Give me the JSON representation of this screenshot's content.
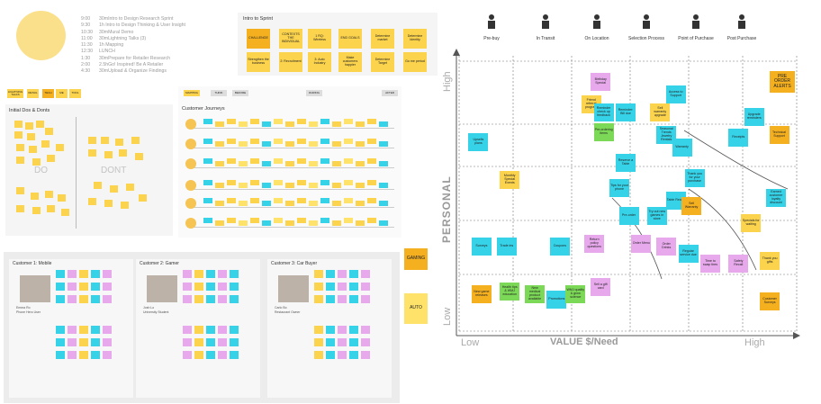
{
  "schedule": [
    {
      "time": "9:00",
      "item": "30mIntro to Design Research Sprint"
    },
    {
      "time": "9:30",
      "item": "1h Intro to Design Thinking & User Insight"
    },
    {
      "time": "10:30",
      "item": "30mMural Demo"
    },
    {
      "time": "11:00",
      "item": "30mLightning Talks (3)"
    },
    {
      "time": "11:30",
      "item": "1h Mapping"
    },
    {
      "time": "12:30",
      "item": "LUNCH"
    },
    {
      "time": "1:30",
      "item": "30mPrepare for Retailer Research"
    },
    {
      "time": "2:00",
      "item": "2.5hGo! Inspired! Be A Retailer"
    },
    {
      "time": "4:30",
      "item": "30mUpload & Organize Findings"
    }
  ],
  "intro": {
    "title": "Intro to Sprint",
    "notes": [
      "CHALLENGE",
      "CONTEXTS THE INDIVIDUAL",
      "1 RQ: Wireless",
      "END GOALS",
      "Determine market",
      "Determine Identity",
      "Strengthen the business",
      "2: Recruitment",
      "3: Auto Industry",
      "Make customers happier",
      "Determine Target",
      "Go me period"
    ]
  },
  "dos": {
    "title": "Initial Dos & Donts",
    "do_label": "DO",
    "dont_label": "DONT"
  },
  "journeys": {
    "title": "Customer Journeys",
    "phases": [
      "MAPPING",
      "THINK",
      "BEFORE",
      "DURING",
      "AFTER"
    ]
  },
  "left_tags": [
    "LIGHTNING TALKS",
    "RETAIL",
    "TECH",
    "ME",
    "TOOL"
  ],
  "personas": [
    {
      "title": "Customer 1: Mobile",
      "name": "Emma Ro",
      "role": "Phone Hero User"
    },
    {
      "title": "Customer 2: Gamer",
      "name": "Josh Lo",
      "role": "University Student"
    },
    {
      "title": "Customer 3: Car Buyer",
      "name": "Carlo Bo",
      "role": "Restaurant Owner"
    }
  ],
  "side_tags": [
    "GAMING",
    "AUTO"
  ],
  "stages": [
    "Pre-buy",
    "In Transit",
    "On Location",
    "Selection Process",
    "Point of Purchase",
    "Post Purchase"
  ],
  "chart_data": {
    "type": "scatter",
    "title": "",
    "xlabel": "VALUE $/Need",
    "ylabel": "PERSONAL",
    "x_ticks": [
      "Low",
      "High"
    ],
    "y_ticks": [
      "High",
      "Low"
    ],
    "corner_note": "PRE ORDER ALERTS",
    "notes": [
      {
        "label": "Birthday Special",
        "x": 0.42,
        "y": 0.94,
        "color": "#e7a9ec"
      },
      {
        "label": "Friend referral program",
        "x": 0.39,
        "y": 0.85,
        "color": "#fbd34d"
      },
      {
        "label": "Reminder check up feedback",
        "x": 0.43,
        "y": 0.82,
        "color": "#36d3e8"
      },
      {
        "label": "Reminder: Bill due",
        "x": 0.5,
        "y": 0.82,
        "color": "#36d3e8"
      },
      {
        "label": "Access to Support",
        "x": 0.66,
        "y": 0.89,
        "color": "#36d3e8"
      },
      {
        "label": "Sell warranty upgrade",
        "x": 0.61,
        "y": 0.82,
        "color": "#fbd34d"
      },
      {
        "label": "Upgrade reminders",
        "x": 0.91,
        "y": 0.8,
        "color": "#36d3e8"
      },
      {
        "label": "Pre-ordering items",
        "x": 0.43,
        "y": 0.74,
        "color": "#7cd957"
      },
      {
        "label": "Seasonal Trends Jewelry Rentals",
        "x": 0.63,
        "y": 0.73,
        "color": "#36d3e8"
      },
      {
        "label": "Receipts",
        "x": 0.86,
        "y": 0.72,
        "color": "#36d3e8"
      },
      {
        "label": "Technical Support",
        "x": 0.99,
        "y": 0.73,
        "color": "#f5b020"
      },
      {
        "label": "Upsells plans",
        "x": 0.03,
        "y": 0.7,
        "color": "#36d3e8"
      },
      {
        "label": "Reserve a Table",
        "x": 0.5,
        "y": 0.62,
        "color": "#36d3e8"
      },
      {
        "label": "Warranty",
        "x": 0.68,
        "y": 0.68,
        "color": "#36d3e8"
      },
      {
        "label": "Monthly Special Events",
        "x": 0.13,
        "y": 0.55,
        "color": "#fbd34d"
      },
      {
        "label": "Tips for your phone",
        "x": 0.48,
        "y": 0.52,
        "color": "#36d3e8"
      },
      {
        "label": "Thank you for your purchase",
        "x": 0.72,
        "y": 0.56,
        "color": "#36d3e8"
      },
      {
        "label": "Table Ready",
        "x": 0.66,
        "y": 0.47,
        "color": "#36d3e8"
      },
      {
        "label": "Sell Warranty",
        "x": 0.71,
        "y": 0.45,
        "color": "#f5b020"
      },
      {
        "label": "Earned customer loyalty discount",
        "x": 0.98,
        "y": 0.48,
        "color": "#36d3e8"
      },
      {
        "label": "Pre-order",
        "x": 0.51,
        "y": 0.41,
        "color": "#36d3e8"
      },
      {
        "label": "Try out new games in store",
        "x": 0.6,
        "y": 0.41,
        "color": "#36d3e8"
      },
      {
        "label": "Specials for waiting",
        "x": 0.9,
        "y": 0.38,
        "color": "#fbd34d"
      },
      {
        "label": "Surveys",
        "x": 0.04,
        "y": 0.29,
        "color": "#36d3e8"
      },
      {
        "label": "Trade ins",
        "x": 0.12,
        "y": 0.29,
        "color": "#36d3e8"
      },
      {
        "label": "Coupons",
        "x": 0.29,
        "y": 0.29,
        "color": "#36d3e8"
      },
      {
        "label": "Return policy questions",
        "x": 0.4,
        "y": 0.3,
        "color": "#e7a9ec"
      },
      {
        "label": "Order Menu",
        "x": 0.55,
        "y": 0.3,
        "color": "#e7a9ec"
      },
      {
        "label": "Order Drinks",
        "x": 0.63,
        "y": 0.29,
        "color": "#e7a9ec"
      },
      {
        "label": "Regular service due",
        "x": 0.7,
        "y": 0.26,
        "color": "#36d3e8"
      },
      {
        "label": "Time to swap tires",
        "x": 0.77,
        "y": 0.22,
        "color": "#e7a9ec"
      },
      {
        "label": "Safety Recall",
        "x": 0.86,
        "y": 0.22,
        "color": "#e7a9ec"
      },
      {
        "label": "Thank you gifts",
        "x": 0.96,
        "y": 0.23,
        "color": "#fbd34d"
      },
      {
        "label": "New game releases",
        "x": 0.04,
        "y": 0.1,
        "color": "#f5b020"
      },
      {
        "label": "Health tips & WMJ education",
        "x": 0.13,
        "y": 0.11,
        "color": "#7cd957"
      },
      {
        "label": "New medical product available",
        "x": 0.21,
        "y": 0.1,
        "color": "#7cd957"
      },
      {
        "label": "Promotions",
        "x": 0.28,
        "y": 0.08,
        "color": "#36d3e8"
      },
      {
        "label": "WMJ quality & grow science",
        "x": 0.34,
        "y": 0.1,
        "color": "#7cd957"
      },
      {
        "label": "Sell a gift card",
        "x": 0.42,
        "y": 0.13,
        "color": "#e7a9ec"
      },
      {
        "label": "Customer Surveys",
        "x": 0.96,
        "y": 0.07,
        "color": "#f5b020"
      }
    ]
  }
}
